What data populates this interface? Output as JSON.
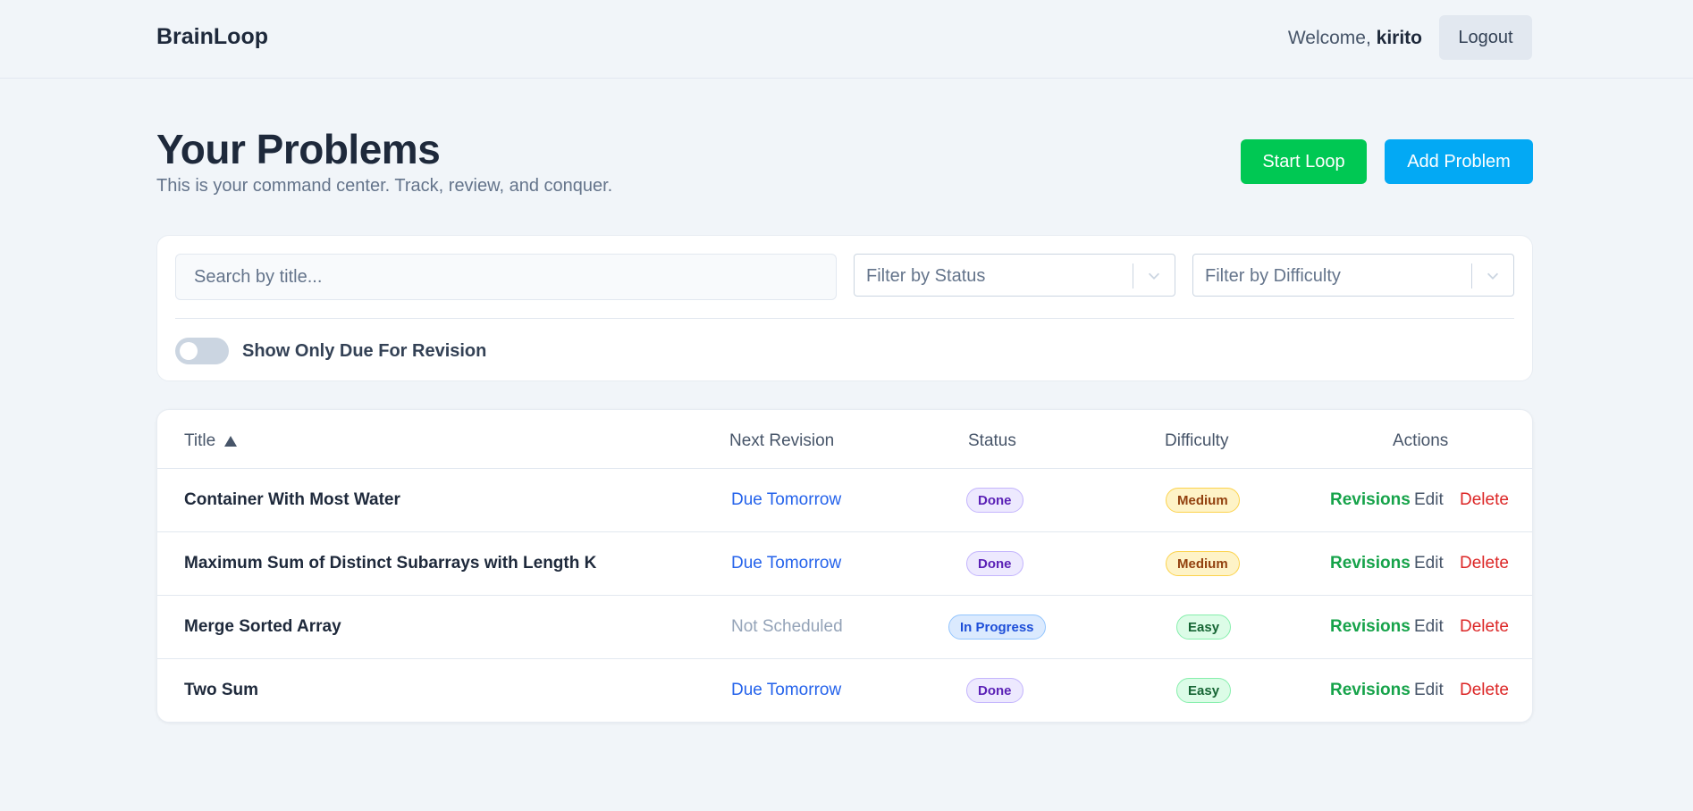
{
  "header": {
    "brand": "BrainLoop",
    "welcome_prefix": "Welcome, ",
    "username": "kirito",
    "logout_label": "Logout"
  },
  "page": {
    "title": "Your Problems",
    "subtitle": "This is your command center. Track, review, and conquer.",
    "start_loop_label": "Start Loop",
    "add_problem_label": "Add Problem"
  },
  "filters": {
    "search_placeholder": "Search by title...",
    "status_placeholder": "Filter by Status",
    "difficulty_placeholder": "Filter by Difficulty",
    "due_toggle_label": "Show Only Due For Revision"
  },
  "table": {
    "columns": {
      "title": "Title",
      "next_revision": "Next Revision",
      "status": "Status",
      "difficulty": "Difficulty",
      "actions": "Actions"
    },
    "rows": [
      {
        "title": "Container With Most Water",
        "next_revision": "Due Tomorrow",
        "status": "Done",
        "difficulty": "Medium"
      },
      {
        "title": "Maximum Sum of Distinct Subarrays with Length K",
        "next_revision": "Due Tomorrow",
        "status": "Done",
        "difficulty": "Medium"
      },
      {
        "title": "Merge Sorted Array",
        "next_revision": "Not Scheduled",
        "status": "In Progress",
        "difficulty": "Easy"
      },
      {
        "title": "Two Sum",
        "next_revision": "Due Tomorrow",
        "status": "Done",
        "difficulty": "Easy"
      }
    ],
    "action_labels": {
      "revisions": "Revisions",
      "edit": "Edit",
      "delete": "Delete"
    }
  },
  "colors": {
    "start_loop": "#00c853",
    "add_problem": "#03a9f4",
    "revisions": "#16a34a",
    "delete": "#dc2626",
    "due_link": "#2563eb"
  },
  "icons": {
    "sort": "sort-ascending-icon",
    "dropdown": "chevron-down-icon"
  }
}
